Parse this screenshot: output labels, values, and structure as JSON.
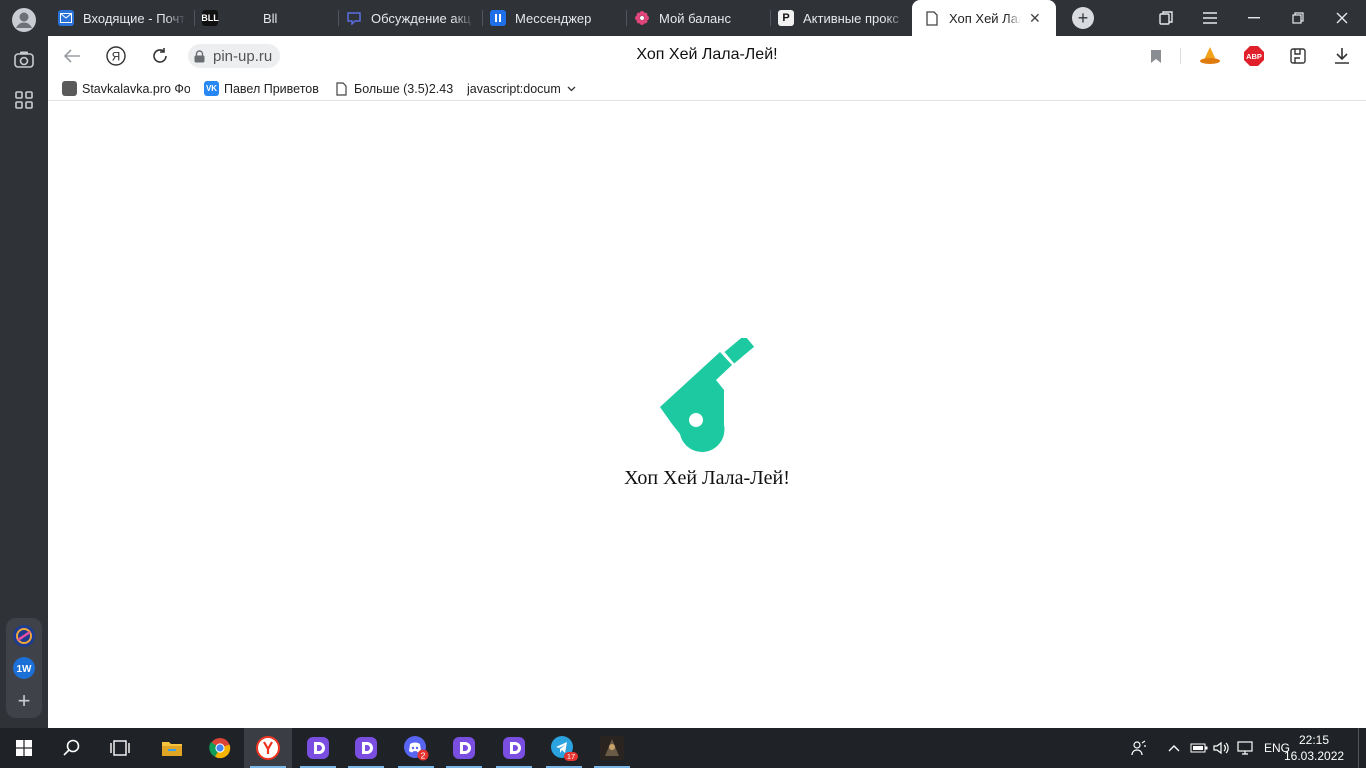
{
  "tabs": [
    {
      "label": "Входящие - Почт",
      "icon": "mail-icon",
      "color": "#2a72d8"
    },
    {
      "label": "Bll",
      "icon": "bll-icon",
      "color": "#111111"
    },
    {
      "label": "Обсуждение акц",
      "icon": "chat-icon",
      "color": "#5a6de0"
    },
    {
      "label": "Мессенджер",
      "icon": "messenger-icon",
      "color": "#1e6fe8"
    },
    {
      "label": "Мой баланс",
      "icon": "flower-icon",
      "color": "#e0457b"
    },
    {
      "label": "Активные прокс",
      "icon": "proxy-icon",
      "color": "#111111"
    },
    {
      "label": "Хоп Хей Лала-",
      "icon": "page-icon",
      "color": "#ffffff"
    }
  ],
  "toolbar": {
    "url": "pin-up.ru",
    "page_title": "Хоп Хей Лала-Лей!",
    "adblock_label": "ABP"
  },
  "bookmarks": [
    {
      "label": "Stavkalavka.pro Фо",
      "icon": "site-icon"
    },
    {
      "label": "Павел Приветов",
      "icon": "vk-icon"
    },
    {
      "label": "Больше (3.5)2.43",
      "icon": "document-icon"
    },
    {
      "label": "javascript:document.c",
      "icon": "script-icon"
    }
  ],
  "content": {
    "loading_text": "Хоп Хей Лала-Лей!",
    "logo_color": "#1cc9a0"
  },
  "taskbar": {
    "discord_badge": "2",
    "telegram_badge": "17",
    "lang": "ENG",
    "time": "22:15",
    "date": "16.03.2022"
  },
  "sidebar": {
    "onewin_label": "1W"
  },
  "colors": {
    "chrome_dark": "#2f3338",
    "taskbar": "#1f2226",
    "accent_green": "#1cc9a0"
  }
}
